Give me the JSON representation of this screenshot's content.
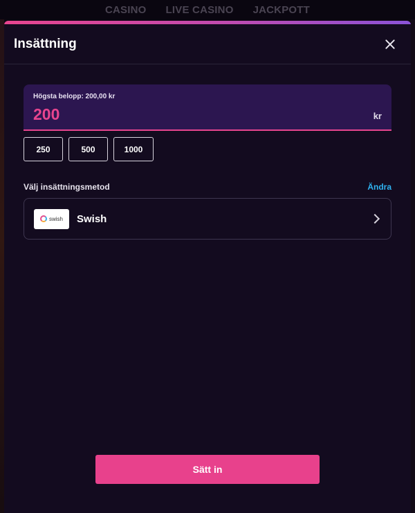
{
  "background_nav": {
    "items": [
      "CASINO",
      "LIVE CASINO",
      "JACKPOTT"
    ]
  },
  "modal": {
    "title": "Insättning",
    "close_icon": "close-icon"
  },
  "amount": {
    "max_label": "Högsta belopp: 200,00 kr",
    "value": "200",
    "currency": "kr"
  },
  "quick_amounts": [
    "250",
    "500",
    "1000"
  ],
  "payment_method": {
    "section_label": "Välj insättningsmetod",
    "change_label": "Ändra",
    "selected_name": "Swish",
    "logo_text": "swish"
  },
  "submit": {
    "label": "Sätt in"
  },
  "colors": {
    "accent": "#e8418c",
    "link": "#2fb2f0",
    "modal_bg": "#130b1f",
    "amount_bg": "#2c1650"
  }
}
